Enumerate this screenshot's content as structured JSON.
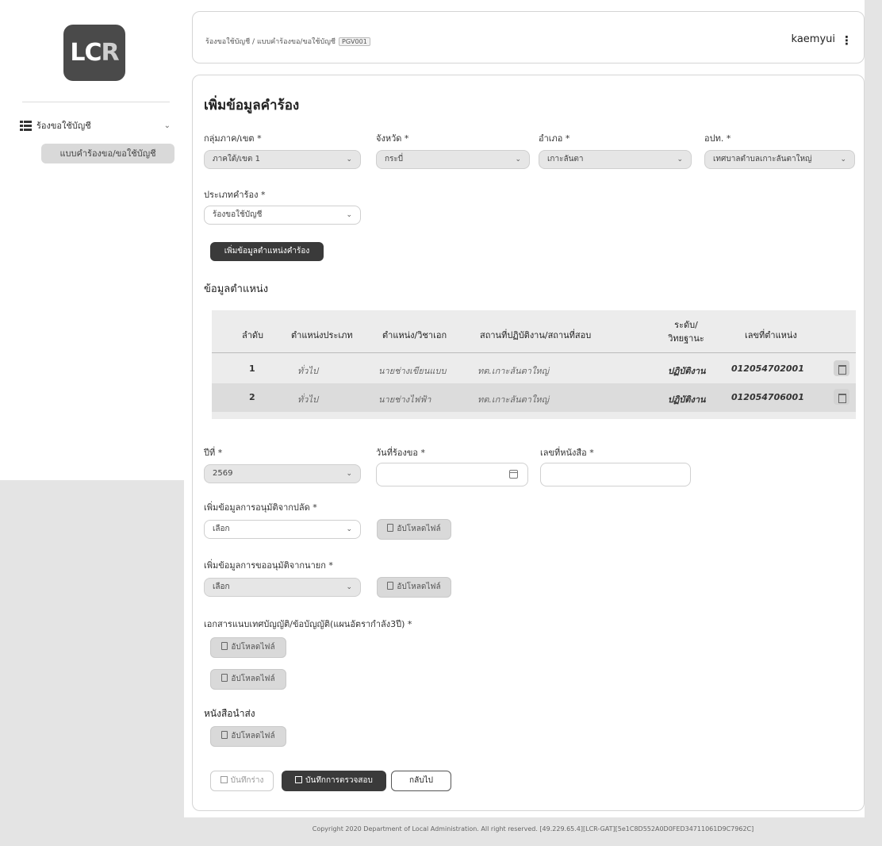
{
  "logo": {
    "text_a": "LC",
    "text_b": "R"
  },
  "sidebar": {
    "group_label": "ร้องขอใช้บัญชี",
    "sub_label": "แบบคำร้องขอ/ขอใช้บัญชี"
  },
  "header": {
    "breadcrumb": "ร้องขอใช้บัญชี / แบบคำร้องขอ/ขอใช้บัญชี",
    "code": "PGV001",
    "username": "kaemyui",
    "kebab": "⋮"
  },
  "form": {
    "title": "เพิ่มข้อมูลคำร้อง",
    "region": {
      "label": "กลุ่มภาค/เขต *",
      "value": "ภาคใต้/เขต 1"
    },
    "province": {
      "label": "จังหวัด *",
      "value": "กระบี่"
    },
    "district": {
      "label": "อำเภอ *",
      "value": "เกาะลันตา"
    },
    "org": {
      "label": "อปท. *",
      "value": "เทศบาลตำบลเกาะลันตาใหญ่"
    },
    "request_type": {
      "label": "ประเภทคำร้อง *",
      "value": "ร้องขอใช้บัญชี"
    },
    "add_position_button": "เพิ่มข้อมูลตำแหน่งคำร้อง",
    "position_section_title": "ข้อมูลตำแหน่ง",
    "year": {
      "label": "ปีที่ *",
      "value": "2569"
    },
    "request_date": {
      "label": "วันที่ร้องขอ *",
      "value": ""
    },
    "letter_no": {
      "label": "เลขที่หนังสือ *",
      "value": ""
    },
    "approval_clerk": {
      "label": "เพิ่มข้อมูลการอนุมัติจากปลัด *",
      "value": "เลือก"
    },
    "approval_mayor": {
      "label": "เพิ่มข้อมูลการขออนุมัติจากนายก *",
      "value": "เลือก"
    },
    "attachment_label": "เอกสารแนบเทศบัญญัติ/ข้อบัญญัติ(แผนอัตรากำลัง3ปี) *",
    "letter_label": "หนังสือนำส่ง",
    "upload_label": "อัปโหลดไฟล์",
    "draft_button": "บันทึกร่าง",
    "save_button": "บันทึกการตรวจสอบ",
    "back_button": "กลับไป"
  },
  "table": {
    "headers": [
      "ลำดับ",
      "ตำแหน่งประเภท",
      "ตำแหน่ง/วิชาเอก",
      "สถานที่ปฏิบัติงาน/สถานที่สอบ",
      "ระดับ/\nวิทยฐานะ",
      "เลขที่ตำแหน่ง"
    ],
    "rows": [
      {
        "no": "1",
        "type": "ทั่วไป",
        "position": "นายช่างเขียนแบบ",
        "place": "ทต.เกาะลันตาใหญ่",
        "level": "ปฏิบัติงาน",
        "number": "012054702001"
      },
      {
        "no": "2",
        "type": "ทั่วไป",
        "position": "นายช่างไฟฟ้า",
        "place": "ทต.เกาะลันตาใหญ่",
        "level": "ปฏิบัติงาน",
        "number": "012054706001"
      }
    ]
  },
  "footer": "Copyright 2020 Department of Local Administration. All right reserved. [49.229.65.4][LCR-GAT][5e1C8D552A0D0FED34711061D9C7962C]"
}
